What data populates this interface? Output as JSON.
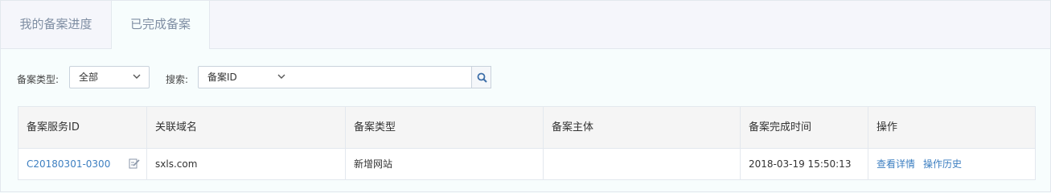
{
  "tabs": [
    {
      "label": "我的备案进度"
    },
    {
      "label": "已完成备案"
    }
  ],
  "filters": {
    "type_label": "备案类型:",
    "type_value": "全部",
    "search_label": "搜索:",
    "search_field_value": "备案ID",
    "search_input_value": ""
  },
  "table": {
    "columns": [
      "备案服务ID",
      "关联域名",
      "备案类型",
      "备案主体",
      "备案完成时间",
      "操作"
    ],
    "rows": [
      {
        "service_id": "C20180301-0300",
        "domain": "sxls.com",
        "type": "新增网站",
        "subject": "",
        "completed_at": "2018-03-19 15:50:13",
        "actions": [
          "查看详情",
          "操作历史"
        ]
      }
    ]
  },
  "icons": {
    "select_arrow": "chevron-down-icon",
    "search": "search-icon",
    "edit": "edit-icon"
  },
  "colors": {
    "link": "#3d7fc1",
    "tab_text": "#7f8ea3",
    "border": "#e3e8ee"
  }
}
